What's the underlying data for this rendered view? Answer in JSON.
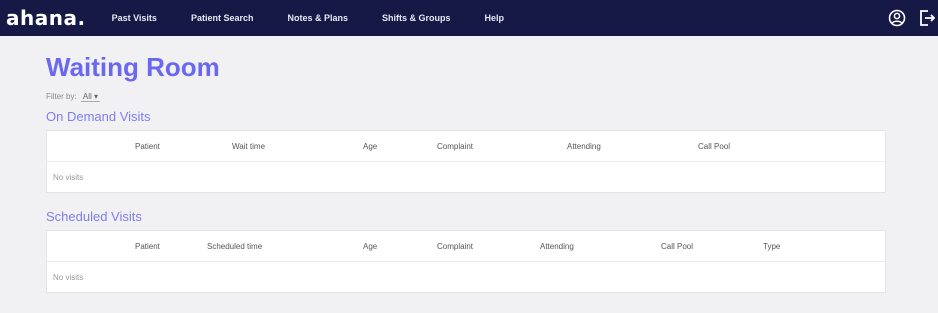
{
  "brand": "ahana.",
  "nav": {
    "items": [
      "Past Visits",
      "Patient Search",
      "Notes & Plans",
      "Shifts & Groups",
      "Help"
    ]
  },
  "icons": {
    "account": "account-circle-icon",
    "logout": "logout-icon"
  },
  "page": {
    "title": "Waiting Room"
  },
  "filter": {
    "label": "Filter by:",
    "value": "All ▾"
  },
  "on_demand": {
    "title": "On Demand Visits",
    "columns": [
      "Patient",
      "Wait time",
      "Age",
      "Complaint",
      "Attending",
      "Call Pool"
    ],
    "empty": "No visits"
  },
  "scheduled": {
    "title": "Scheduled Visits",
    "columns": [
      "Patient",
      "Scheduled time",
      "Age",
      "Complaint",
      "Attending",
      "Call Pool",
      "Type"
    ],
    "empty": "No visits"
  },
  "colors": {
    "navbar": "#161846",
    "accent": "#6b68f0",
    "background": "#f1f1f3"
  }
}
